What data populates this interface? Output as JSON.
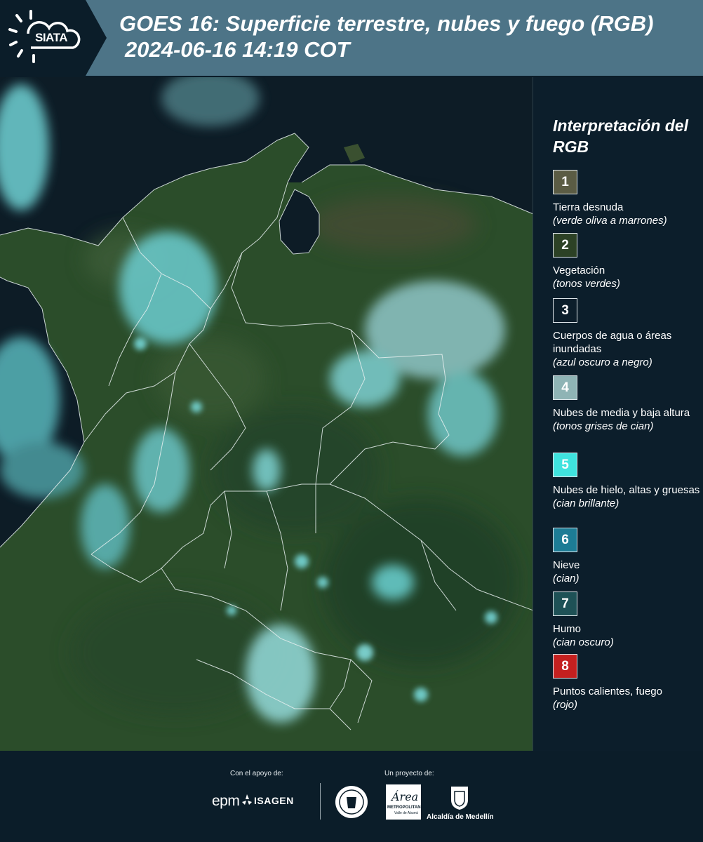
{
  "header": {
    "title_line1": "GOES 16: Superficie terrestre, nubes y fuego (RGB)",
    "title_line2": "2024-06-16 14:19 COT",
    "logo_text": "SIATA"
  },
  "legend": {
    "title": "Interpretación del RGB",
    "items": [
      {
        "num": "1",
        "name": "Tierra desnuda",
        "desc": "(verde oliva a marrones)",
        "color": "#5b5c44"
      },
      {
        "num": "2",
        "name": "Vegetación",
        "desc": "(tonos verdes)",
        "color": "#2c4125"
      },
      {
        "num": "3",
        "name": "Cuerpos de agua o áreas inundadas",
        "desc": "(azul oscuro a negro)",
        "color": "#0c1e2b"
      },
      {
        "num": "4",
        "name": "Nubes de media y baja altura",
        "desc": "(tonos grises de cian)",
        "color": "#8fb4b5"
      },
      {
        "num": "5",
        "name": "Nubes de hielo, altas y gruesas",
        "desc": "(cian brillante)",
        "color": "#3fe3de"
      },
      {
        "num": "6",
        "name": "Nieve",
        "desc": "(cian)",
        "color": "#1d7c95"
      },
      {
        "num": "7",
        "name": "Humo",
        "desc": "(cian oscuro)",
        "color": "#1e5156"
      },
      {
        "num": "8",
        "name": "Puntos calientes, fuego",
        "desc": "(rojo)",
        "color": "#c4201f"
      }
    ]
  },
  "footer": {
    "support_label": "Con el apoyo de:",
    "project_label": "Un proyecto de:",
    "logo_epm": "epm",
    "logo_isagen": "ISAGEN",
    "logo_area_line1": "Área",
    "logo_area_line2": "METROPOLITANA",
    "logo_area_line3": "Valle de Aburrá",
    "logo_alcaldia": "Alcaldía de Medellín"
  },
  "colors": {
    "header_bg": "#4d7487",
    "page_bg": "#0b1d29",
    "ocean": "#0d1c26",
    "land": "#2d4f2c",
    "cloud_cyan": "#6fd6d8"
  }
}
